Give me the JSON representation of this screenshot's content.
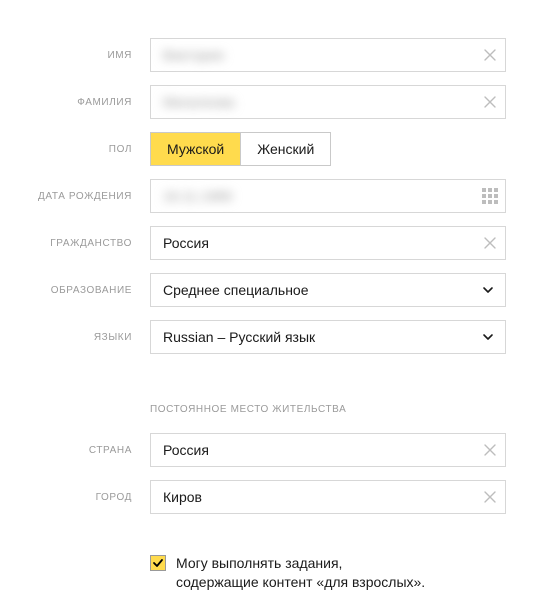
{
  "labels": {
    "first_name": "ИМЯ",
    "last_name": "ФАМИЛИЯ",
    "gender": "ПОЛ",
    "birth_date": "ДАТА РОЖДЕНИЯ",
    "citizenship": "ГРАЖДАНСТВО",
    "education": "ОБРАЗОВАНИЕ",
    "languages": "ЯЗЫКИ",
    "country": "СТРАНА",
    "city": "ГОРОД"
  },
  "values": {
    "first_name": "Виктория",
    "last_name": "Михалкова",
    "birth_date": "16.11.1989",
    "citizenship": "Россия",
    "education": "Среднее специальное",
    "languages": "Russian – Русский язык",
    "country": "Россия",
    "city": "Киров"
  },
  "gender": {
    "male": "Мужской",
    "female": "Женский",
    "selected": "male"
  },
  "section": {
    "residence": "ПОСТОЯННОЕ МЕСТО ЖИТЕЛЬСТВА"
  },
  "checkbox": {
    "adult_line1": "Могу выполнять задания,",
    "adult_line2": "содержащие контент «для взрослых».",
    "checked": true
  }
}
